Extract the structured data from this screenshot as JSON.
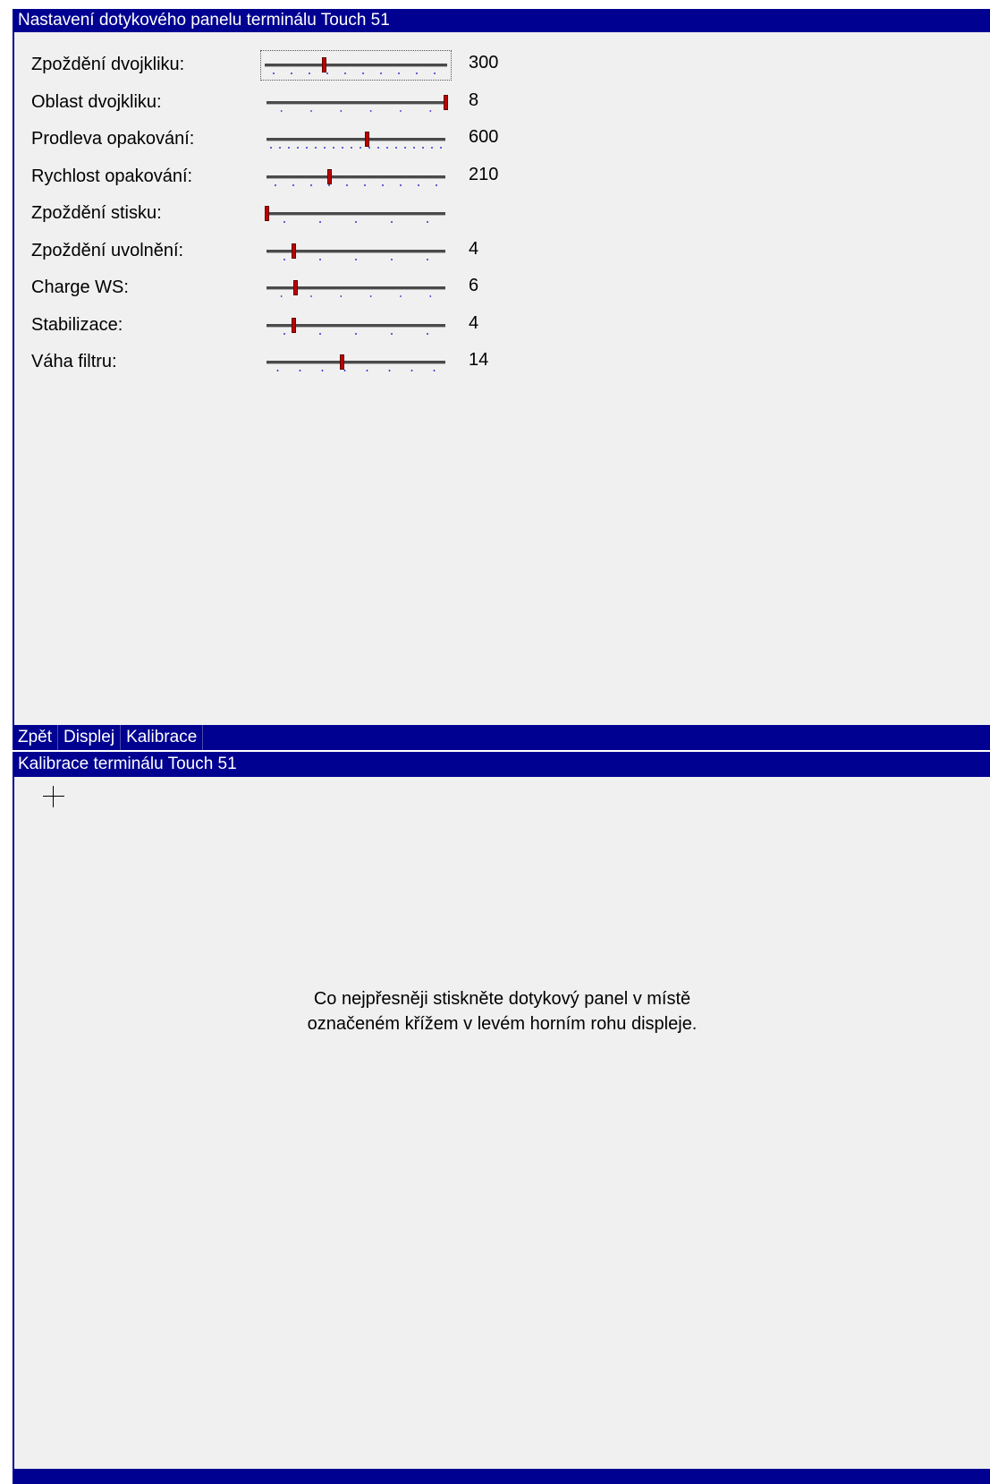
{
  "settings": {
    "title": "Nastavení dotykového panelu terminálu Touch 51",
    "rows": [
      {
        "label": "Zpoždění dvojkliku:",
        "value": "300",
        "position": 0.33,
        "ticks": 10
      },
      {
        "label": "Oblast dvojkliku:",
        "value": "8",
        "position": 1.0,
        "ticks": 6
      },
      {
        "label": "Prodleva opakování:",
        "value": "600",
        "position": 0.56,
        "ticks": 20
      },
      {
        "label": "Rychlost opakování:",
        "value": "210",
        "position": 0.35,
        "ticks": 10
      },
      {
        "label": "Zpoždění stisku:",
        "value": "",
        "position": 0.0,
        "ticks": 5
      },
      {
        "label": "Zpoždění uvolnění:",
        "value": "4",
        "position": 0.15,
        "ticks": 5
      },
      {
        "label": "Charge WS:",
        "value": "6",
        "position": 0.16,
        "ticks": 6
      },
      {
        "label": "Stabilizace:",
        "value": "4",
        "position": 0.15,
        "ticks": 5
      },
      {
        "label": "Váha filtru:",
        "value": "14",
        "position": 0.42,
        "ticks": 8
      }
    ]
  },
  "menu": {
    "items": [
      "Zpět",
      "Displej",
      "Kalibrace"
    ]
  },
  "calibration": {
    "title": "Kalibrace terminálu Touch 51",
    "instruction_line1": "Co nejpřesněji stiskněte dotykový panel v místě",
    "instruction_line2": "označeném křížem v levém horním rohu displeje."
  },
  "colors": {
    "title_bar": "#000091",
    "panel_background": "#f0f0f0",
    "slider_thumb": "#c00000",
    "tick_marks": "#3333cc"
  }
}
